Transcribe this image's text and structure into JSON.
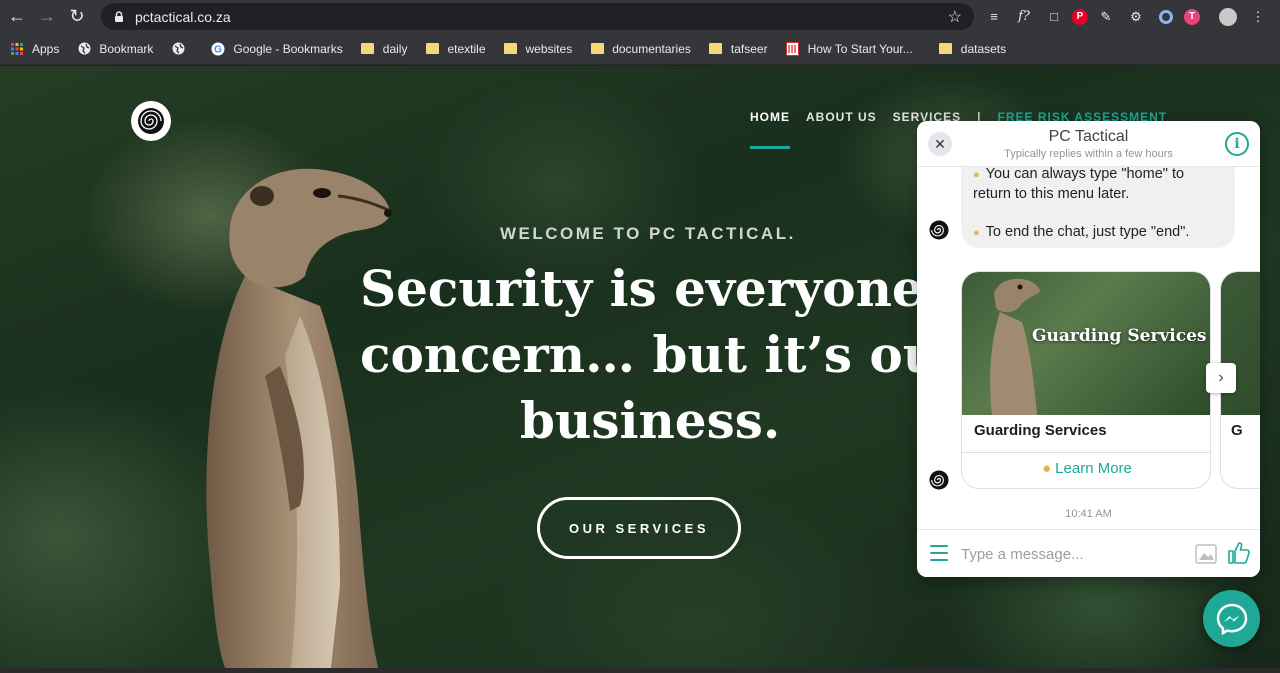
{
  "browser": {
    "url": "pctactical.co.za",
    "bookmarks": [
      {
        "label": "Apps",
        "icon": "apps-grid-icon"
      },
      {
        "label": "Bookmark",
        "icon": "globe-icon"
      },
      {
        "label": "",
        "icon": "globe-icon"
      },
      {
        "label": "Google - Bookmarks",
        "icon": "google-icon"
      },
      {
        "label": "daily",
        "icon": "folder-icon"
      },
      {
        "label": "etextile",
        "icon": "folder-icon"
      },
      {
        "label": "websites",
        "icon": "folder-icon"
      },
      {
        "label": "documentaries",
        "icon": "folder-icon"
      },
      {
        "label": "tafseer",
        "icon": "folder-icon"
      },
      {
        "label": "How To Start Your...",
        "icon": "red-book-icon"
      },
      {
        "label": "datasets",
        "icon": "folder-icon"
      }
    ],
    "extensions": [
      "layers-icon",
      "formula-icon",
      "pocket-icon",
      "pinterest-icon",
      "pen-icon",
      "gear-icon",
      "circle-icon",
      "t-badge-icon",
      "profile-icon"
    ]
  },
  "site": {
    "nav": {
      "home": "HOME",
      "about": "ABOUT US",
      "services": "SERVICES",
      "separator": "|",
      "cta": "FREE RISK ASSESSMENT"
    },
    "welcome": "WELCOME TO PC TACTICAL.",
    "headline": {
      "line1": "Security is everyone’s",
      "line2": "concern… but it’s our",
      "line3": "business."
    },
    "button": "OUR SERVICES"
  },
  "chat": {
    "title": "PC Tactical",
    "subtitle": "Typically replies within a few hours",
    "message": {
      "line1": "You can always type \"home\" to return to this menu later.",
      "line2": "To end the chat, just type \"end\"."
    },
    "card": {
      "image_text": "Guarding Services",
      "title": "Guarding Services",
      "link": "Learn More"
    },
    "card2_title_fragment": "G",
    "timestamp": "10:41 AM",
    "input_placeholder": "Type a message..."
  },
  "colors": {
    "accent": "#1fa896",
    "chrome": "#35363a",
    "omnibox": "#202124"
  }
}
